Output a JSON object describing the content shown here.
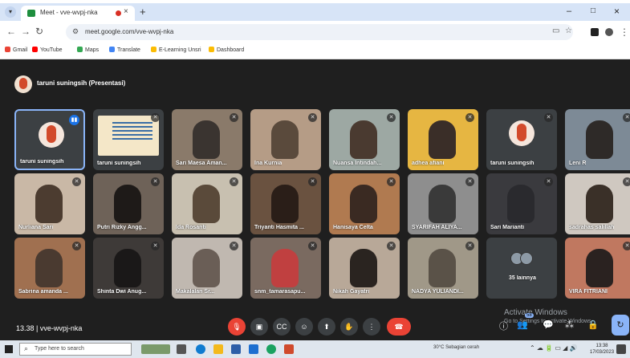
{
  "browser": {
    "tab_title": "Meet - vve-wvpj-nka",
    "tab_close": "×",
    "new_tab": "+",
    "url": "meet.google.com/vve-wvpj-nka",
    "window_controls": {
      "minimize": "–",
      "maximize": "□",
      "close": "×"
    }
  },
  "bookmarks": [
    {
      "label": "Gmail",
      "color": "#ea4335"
    },
    {
      "label": "YouTube",
      "color": "#ff0000"
    },
    {
      "label": "Maps",
      "color": "#34a853"
    },
    {
      "label": "Translate",
      "color": "#4285f4"
    },
    {
      "label": "E-Learning Unsri",
      "color": "#fbbc04"
    },
    {
      "label": "Dashboard",
      "color": "#fbbc04"
    }
  ],
  "meet": {
    "presenter_chip": "taruni suningsih (Presentasi)",
    "participants": [
      {
        "name": "taruni suningsih",
        "kind": "avatar",
        "active": true
      },
      {
        "name": "taruni suningsih",
        "kind": "slide"
      },
      {
        "name": "Sari Maesa Aman...",
        "kind": "video",
        "bg": "#8a7a6a",
        "face": "#3a3430"
      },
      {
        "name": "Ina Kurnia",
        "kind": "video",
        "bg": "#b59c86",
        "face": "#5a4a3c"
      },
      {
        "name": "Nuansa Intindah...",
        "kind": "video",
        "bg": "#9da8a3",
        "face": "#4a3a30"
      },
      {
        "name": "adhea afiani",
        "kind": "video",
        "bg": "#e6b642",
        "face": "#3a2e28"
      },
      {
        "name": "taruni suningsih",
        "kind": "avatar"
      },
      {
        "name": "Leni R",
        "kind": "video",
        "bg": "#7d8a96",
        "face": "#2e2a28"
      },
      {
        "name": "Nurliana Sari",
        "kind": "video",
        "bg": "#c9b8a6",
        "face": "#4c3c30"
      },
      {
        "name": "Putri Rizky Angg...",
        "kind": "video",
        "bg": "#6e6258",
        "face": "#1e1a18"
      },
      {
        "name": "Ida Rosanti",
        "kind": "video",
        "bg": "#c8c0b0",
        "face": "#5a4a3a"
      },
      {
        "name": "Triyanti Hasmita ...",
        "kind": "video",
        "bg": "#6a5240",
        "face": "#2a1e18"
      },
      {
        "name": "Hanisaya Celta",
        "kind": "video",
        "bg": "#b07a50",
        "face": "#3a2a22"
      },
      {
        "name": "SYARIFAH ALIYA...",
        "kind": "video",
        "bg": "#8e8e8e",
        "face": "#3a3a3a"
      },
      {
        "name": "Sari Marianti",
        "kind": "video",
        "bg": "#3a3a3e",
        "face": "#2a2a2e"
      },
      {
        "name": "sadrahas salillah",
        "kind": "video",
        "bg": "#cfc8c0",
        "face": "#3a3028"
      },
      {
        "name": "Sabrina amanda ...",
        "kind": "video",
        "bg": "#a07050",
        "face": "#4a3a30"
      },
      {
        "name": "Shinta Dwi Anug...",
        "kind": "video",
        "bg": "#3e3a38",
        "face": "#1a1818"
      },
      {
        "name": "Makalalan Sr...",
        "kind": "video",
        "bg": "#c0b8b0",
        "face": "#6a5e56"
      },
      {
        "name": "snm_tamarasapu...",
        "kind": "video",
        "bg": "#7a6a60",
        "face": "#c04040"
      },
      {
        "name": "Nikah Gayatri",
        "kind": "video",
        "bg": "#b8a898",
        "face": "#2a2420"
      },
      {
        "name": "NADYA YULIANDI...",
        "kind": "video",
        "bg": "#a09888",
        "face": "#5a5248"
      },
      {
        "name": "35 lainnya",
        "kind": "more"
      },
      {
        "name": "VIRA FITRIANI",
        "kind": "video",
        "bg": "#c07860",
        "face": "#2a2220"
      }
    ],
    "meeting_info": "13.38  |  vve-wvpj-nka",
    "controls": [
      "mic-off",
      "camera",
      "captions",
      "emoji",
      "present",
      "raise-hand",
      "more",
      "leave-call"
    ],
    "control_glyphs": {
      "mic": "🎙",
      "camera": "▣",
      "captions": "CC",
      "emoji": "☺",
      "present": "⬆",
      "hand": "✋",
      "more": "⋮",
      "leave": "☎"
    },
    "participant_count_badge": "58",
    "activate_windows": "Activate Windows",
    "activate_sub": "Go to Settings to activate Windows."
  },
  "taskbar": {
    "search_placeholder": "Type here to search",
    "weather": "30°C  Sebagian cerah",
    "time": "13:38",
    "date": "17/03/2023"
  }
}
